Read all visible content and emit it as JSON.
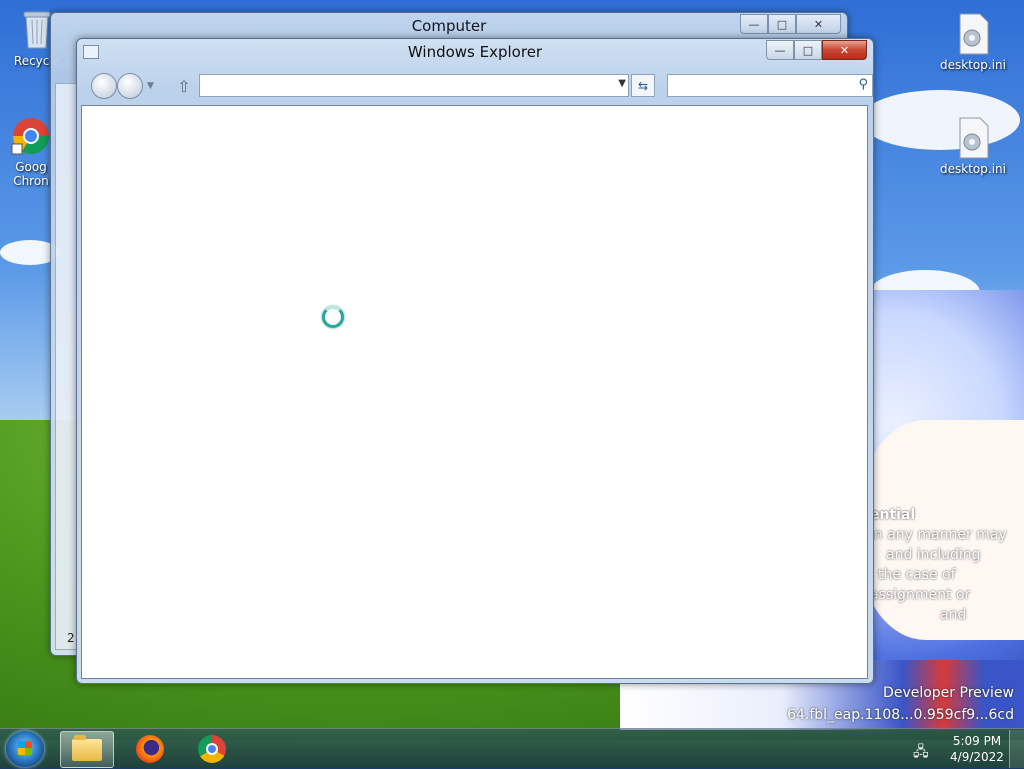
{
  "desktop": {
    "icons": [
      {
        "label": "Recycle",
        "name": "recycle-bin"
      },
      {
        "label": "Goog\nChron",
        "name": "google-chrome"
      },
      {
        "label": "desktop.ini",
        "name": "desktop-ini-1"
      },
      {
        "label": "desktop.ini",
        "name": "desktop-ini-2"
      }
    ],
    "overlay_lines": [
      "ential",
      "in any manner may",
      "and including",
      "the case of",
      "assignment or",
      "and"
    ],
    "watermark_line1": "Developer Preview",
    "watermark_line2": "64.fbl_eap.1108...0.959cf9...6cd"
  },
  "windows": {
    "back": {
      "title": "Computer",
      "status_text": "2"
    },
    "front": {
      "title": "Windows Explorer",
      "address_value": "",
      "search_placeholder": ""
    }
  },
  "taskbar": {
    "items": [
      "explorer",
      "firefox",
      "chrome"
    ],
    "clock": {
      "time": "5:09 PM",
      "date": "4/9/2022"
    }
  }
}
